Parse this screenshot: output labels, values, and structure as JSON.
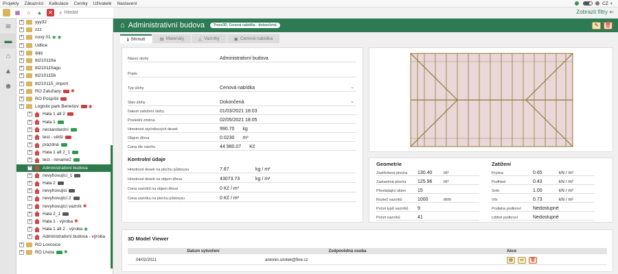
{
  "menu": {
    "items": [
      "Projekty",
      "Zákazníci",
      "Kalkulace",
      "Ceníky",
      "Uživatelé",
      "Nastavení"
    ],
    "language": "CZ"
  },
  "toolbar": {
    "search_placeholder": "Hledat"
  },
  "filters_link": "Zobrazit filtry",
  "tree": {
    "items": [
      {
        "label": "yyy32",
        "type": "folder",
        "level": 0
      },
      {
        "label": "zzz",
        "type": "folder",
        "level": 0
      },
      {
        "label": "nový 01",
        "type": "folder",
        "level": 0,
        "gears": [
          "g",
          "g"
        ]
      },
      {
        "label": "Udlice",
        "type": "folder",
        "level": 0
      },
      {
        "label": "qqq",
        "type": "folder",
        "level": 0
      },
      {
        "label": "ttt210119a",
        "type": "folder",
        "level": 0
      },
      {
        "label": "ttt210115agu",
        "type": "folder",
        "level": 0
      },
      {
        "label": "ttt210115b",
        "type": "folder",
        "level": 0
      },
      {
        "label": "ttt210115_import",
        "type": "folder",
        "level": 0
      },
      {
        "label": "RO Zalužany",
        "type": "folder",
        "level": 0,
        "badges": [
          "r"
        ],
        "gears": [
          "r"
        ]
      },
      {
        "label": "RO Pospíšil",
        "type": "folder",
        "level": 0,
        "badges": [
          "r"
        ]
      },
      {
        "label": "Logistic park Benešov",
        "type": "folder",
        "level": 0,
        "badges": [
          "r"
        ],
        "gears": [
          "r"
        ]
      },
      {
        "label": "Hala 1 alt 2",
        "type": "house",
        "level": 1,
        "badges": [
          "r"
        ]
      },
      {
        "label": "Hala 1",
        "type": "house",
        "level": 1,
        "badges": [
          "g"
        ]
      },
      {
        "label": "nestandardní",
        "type": "house",
        "level": 1,
        "badges": [
          "g"
        ]
      },
      {
        "label": "test - větší",
        "type": "house",
        "level": 1,
        "badges": [
          "r"
        ]
      },
      {
        "label": "prázdná",
        "type": "house",
        "level": 1,
        "badges": [
          "g"
        ]
      },
      {
        "label": "Hala 1 alt 2_1",
        "type": "house",
        "level": 1,
        "badges": [
          "g"
        ]
      },
      {
        "label": "test - rename2",
        "type": "house",
        "level": 1,
        "badges": [
          "g"
        ]
      },
      {
        "label": "Administrativní budova",
        "type": "house",
        "level": 1,
        "selected": true
      },
      {
        "label": "nevyhovující_1",
        "type": "house",
        "level": 1,
        "badges": [
          "k"
        ]
      },
      {
        "label": "Hala 2",
        "type": "house",
        "level": 1,
        "badges": [
          "k"
        ]
      },
      {
        "label": "nevyhovujici",
        "type": "house",
        "level": 1,
        "badges": [
          "k"
        ]
      },
      {
        "label": "nevyhovující 2",
        "type": "house",
        "level": 1,
        "badges": [
          "k"
        ]
      },
      {
        "label": "nevyhovující vazník",
        "type": "house",
        "level": 1,
        "gears": [
          "r"
        ]
      },
      {
        "label": "Hala 2_1",
        "type": "house",
        "level": 1,
        "badges": [
          "k"
        ]
      },
      {
        "label": "Hala 1 - výroba",
        "type": "house",
        "level": 1,
        "gears": [
          "r"
        ]
      },
      {
        "label": "Hala 1 alt 2 - výroba",
        "type": "house",
        "level": 1,
        "gears": [
          "g"
        ]
      },
      {
        "label": "Administrativní budova - výroba",
        "type": "house",
        "level": 1
      },
      {
        "label": "RO Lovosice",
        "type": "folder",
        "level": 0
      },
      {
        "label": "RO Lhota",
        "type": "folder",
        "level": 0,
        "badges": [
          "g"
        ],
        "gears": [
          "g"
        ]
      }
    ]
  },
  "header": {
    "title": "Administrativní budova",
    "status": "Truss3D, Cenová nabídka - dokončená"
  },
  "tabs": [
    "Shrnutí",
    "Materiály",
    "Vazníky",
    "Cenová nabídka"
  ],
  "summary": {
    "fields": [
      {
        "label": "Název úlohy",
        "value": "Administrativní budova"
      },
      {
        "label": "Popis",
        "value": ""
      },
      {
        "label": "Typ úlohy",
        "value": "Cenová nabídka",
        "select": true
      },
      {
        "label": "Stav úlohy",
        "value": "Dokončená",
        "select": true
      },
      {
        "label": "Datum založení úlohy",
        "value": "01/03/2021 18:03"
      },
      {
        "label": "Poslední změna",
        "value": "02/05/2021 18:05"
      },
      {
        "label": "Hmotnost styčníkových desek",
        "value": "990.70",
        "unit": "kg"
      },
      {
        "label": "Objem dřeva",
        "value": "0.0230",
        "unit": "m³"
      },
      {
        "label": "Cena dle návrhu",
        "value": "44 980.07",
        "unit": "Kč"
      }
    ],
    "control_title": "Kontrolní údaje",
    "control": [
      {
        "label": "Hmotnost desek na plochu půdorysu",
        "value": "7.87",
        "unit": "kg / m²"
      },
      {
        "label": "Hmotnost desek na objem dřeva",
        "value": "43073.73",
        "unit": "kg / m³"
      },
      {
        "label": "Cena vazníků na objem dřeva",
        "value": "0 Kč / m³"
      },
      {
        "label": "Cena vazníku na plochu půdorysu",
        "value": "0 Kč / m²"
      }
    ]
  },
  "geometry": {
    "title": "Geometrie",
    "rows": [
      {
        "label": "Zastřešená plocha",
        "value": "130.40",
        "unit": "m²"
      },
      {
        "label": "Zastavěná plocha",
        "value": "125.96",
        "unit": "m²"
      },
      {
        "label": "Převládající sklon",
        "value": "15",
        "unit": ""
      },
      {
        "label": "Rozteč vazníků",
        "value": "1000",
        "unit": "mm"
      },
      {
        "label": "Počet typů vazníků",
        "value": "9",
        "unit": ""
      },
      {
        "label": "Počet vazníků",
        "value": "41",
        "unit": ""
      }
    ]
  },
  "loads": {
    "title": "Zatížení",
    "rows": [
      {
        "label": "Krytina",
        "value": "0.65",
        "unit": "kN / m²"
      },
      {
        "label": "Podhled",
        "value": "0.43",
        "unit": "kN / m²"
      },
      {
        "label": "Sníh",
        "value": "1.00",
        "unit": "kN / m²"
      },
      {
        "label": "Vítr",
        "value": "0.73",
        "unit": "kN / m²"
      },
      {
        "label": "Podlaha podkroví",
        "value": "Nedostupné",
        "unit": ""
      },
      {
        "label": "Užitné podkroví",
        "value": "Nedostupné",
        "unit": ""
      }
    ]
  },
  "viewer": {
    "title": "3D Model Viewer",
    "columns": [
      "Datum vytvoření",
      "Zodpovědná osoba",
      "Akce"
    ],
    "rows": [
      {
        "date": "04/02/2021",
        "person": "antonin.sirotek@fine.cz"
      }
    ]
  }
}
